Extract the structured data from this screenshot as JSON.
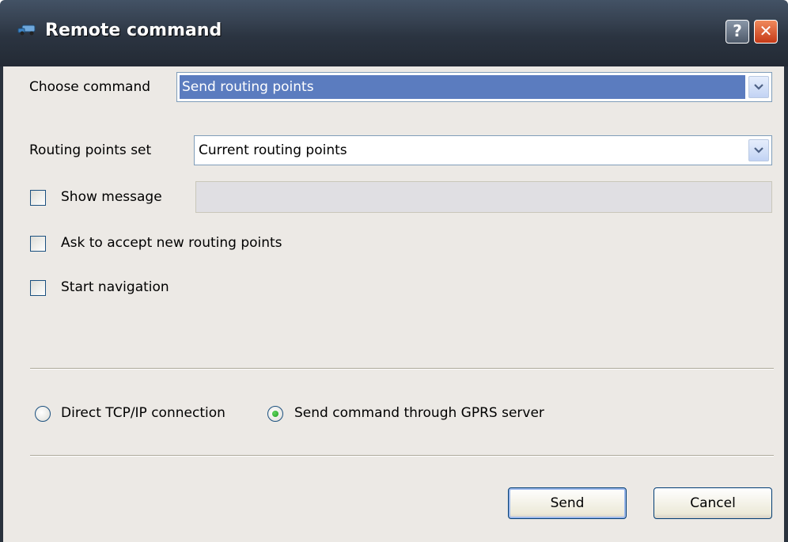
{
  "window": {
    "title": "Remote command",
    "help_glyph": "?",
    "close_glyph": "✕"
  },
  "form": {
    "choose_command_label": "Choose command",
    "choose_command_value": "Send routing points",
    "routing_points_set_label": "Routing points set",
    "routing_points_set_value": "Current routing points",
    "show_message_label": "Show message",
    "show_message_value": "",
    "ask_accept_label": "Ask to accept new routing points",
    "start_navigation_label": "Start navigation"
  },
  "connection": {
    "direct_label": "Direct TCP/IP connection",
    "gprs_label": "Send command through GPRS server",
    "selected": "gprs"
  },
  "buttons": {
    "send_label": "Send",
    "cancel_label": "Cancel"
  },
  "icons": {
    "title_icon": "vehicle-icon",
    "dropdown_arrow": "chevron-down-icon"
  }
}
